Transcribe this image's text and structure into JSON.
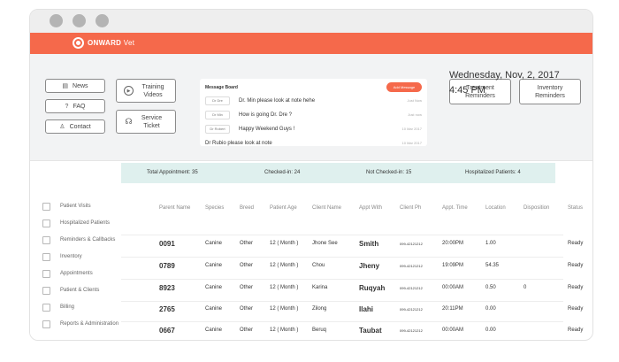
{
  "brand": {
    "name_bold": "ONWARD",
    "name_thin": "Vet",
    "accent": "#f5694b"
  },
  "quick_buttons": {
    "news": "News",
    "faq": "FAQ",
    "contact": "Contact",
    "training_videos": "Training Videos",
    "service_ticket": "Service Ticket",
    "treatment_reminders": "Treatment Reminders",
    "inventory_reminders": "Inventory Reminders"
  },
  "message_board": {
    "title": "Message Board",
    "add_label": "Add Message",
    "rows": [
      {
        "tag": "Dr Dre",
        "text": "Dr. Min please look at note hehe",
        "time": "Just Now"
      },
      {
        "tag": "Dr Min",
        "text": "How is going Dr. Dre ?",
        "time": "Just now"
      },
      {
        "tag": "Dr Robert",
        "text": "Happy Weekend Guys !",
        "time": "10 Mar 2017"
      },
      {
        "tag": "",
        "text": "Dr Rubio please look at note",
        "time": "10 Mar 2017"
      }
    ]
  },
  "datetime": {
    "date": "Wednesday, Nov, 2, 2017",
    "time": "4:45 PM"
  },
  "sidebar": {
    "items": [
      "Patient Visits",
      "Hospitalized Patients",
      "Reminders & Callbacks",
      "Inventory",
      "Appointments",
      "Patient & Clients",
      "Billing",
      "Reports & Administration"
    ]
  },
  "summary": {
    "total": "Total Appointment: 35",
    "checked_in": "Checked-in: 24",
    "not_checked_in": "Not Checked-in: 15",
    "hospitalized": "Hospitalized Patients: 4"
  },
  "table": {
    "headers": [
      "Parent Name",
      "Species",
      "Breed",
      "Patient Age",
      "Client Name",
      "Appt With",
      "Client Ph",
      "Appt. Time",
      "Location",
      "Disposition",
      "Status"
    ],
    "rows": [
      [
        "0091",
        "Canine",
        "Other",
        "12 ( Month )",
        "Jhone See",
        "Smith",
        "099-42121212",
        "20:00PM",
        "1.00",
        "",
        "Ready"
      ],
      [
        "0789",
        "Canine",
        "Other",
        "12 ( Month )",
        "Chou",
        "Jheny",
        "099-42121212",
        "19:09PM",
        "54.35",
        "",
        "Ready"
      ],
      [
        "8923",
        "Canine",
        "Other",
        "12 ( Month )",
        "Karina",
        "Ruqyah",
        "099-42121212",
        "00:00AM",
        "0.50",
        "0",
        "Ready"
      ],
      [
        "2765",
        "Canine",
        "Other",
        "12 ( Month )",
        "Zilong",
        "Ilahi",
        "099-42121212",
        "20:11PM",
        "0.00",
        "",
        "Ready"
      ],
      [
        "0667",
        "Canine",
        "Other",
        "12 ( Month )",
        "Beruq",
        "Taubat",
        "099-42121212",
        "00:00AM",
        "0.00",
        "",
        "Ready"
      ]
    ]
  }
}
